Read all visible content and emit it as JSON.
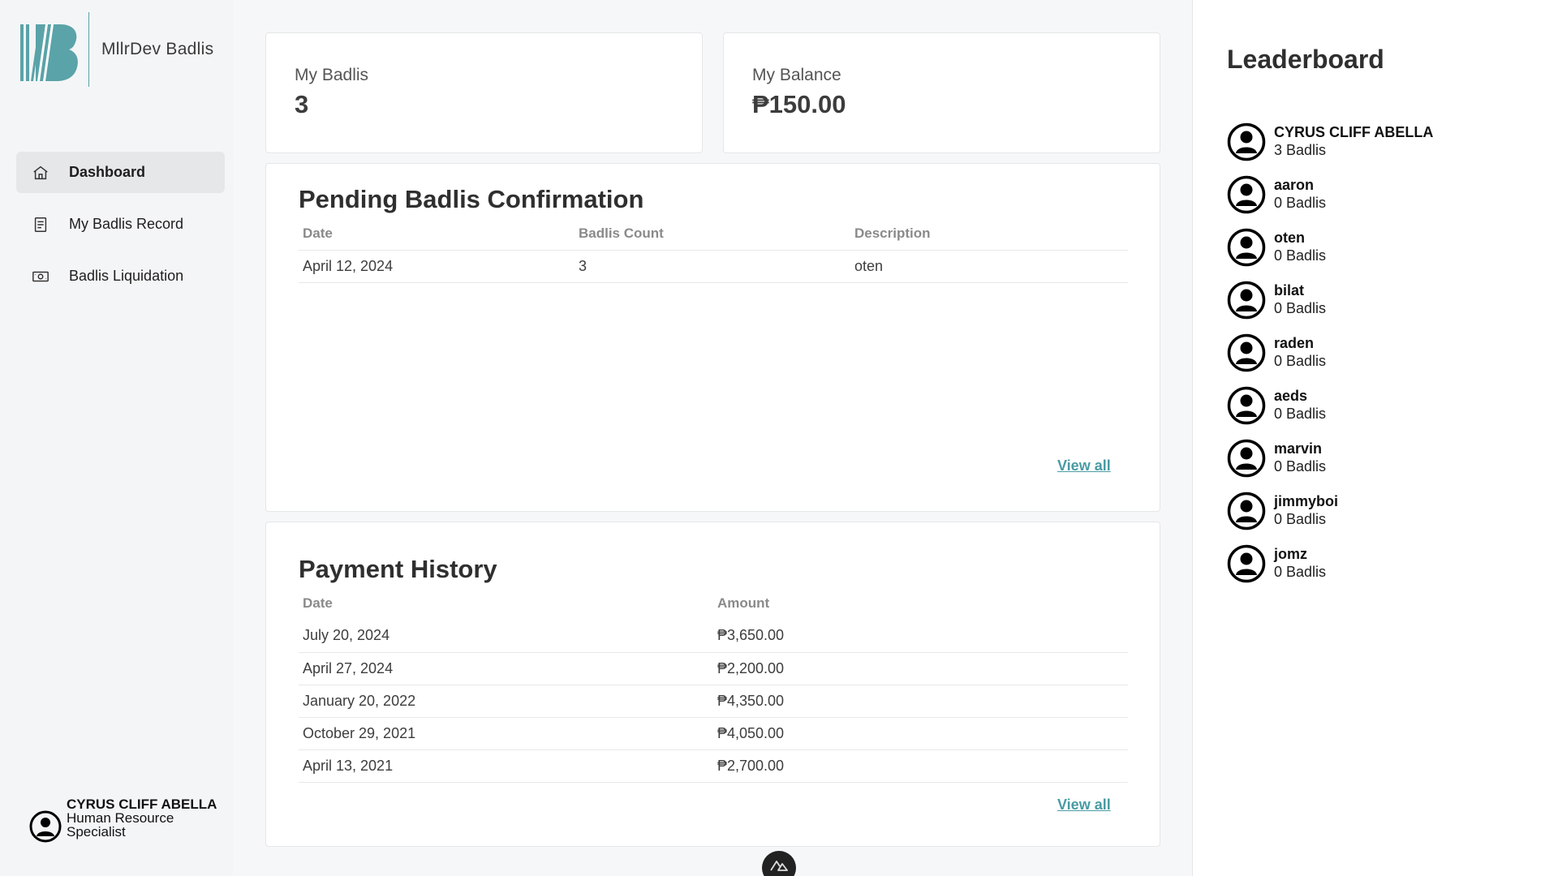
{
  "brand": {
    "name": "MllrDev Badlis",
    "accent": "#5aa3a8"
  },
  "sidebar": {
    "items": [
      {
        "label": "Dashboard",
        "icon": "home-icon",
        "active": true
      },
      {
        "label": "My Badlis Record",
        "icon": "document-icon",
        "active": false
      },
      {
        "label": "Badlis Liquidation",
        "icon": "cash-icon",
        "active": false
      }
    ],
    "user": {
      "name": "CYRUS CLIFF ABELLA",
      "role": "Human Resource Specialist"
    }
  },
  "stats": {
    "badlis": {
      "label": "My Badlis",
      "value": "3"
    },
    "balance": {
      "label": "My Balance",
      "value": "₱150.00"
    }
  },
  "pending": {
    "title": "Pending Badlis Confirmation",
    "columns": [
      "Date",
      "Badlis Count",
      "Description"
    ],
    "rows": [
      [
        "April 12, 2024",
        "3",
        "oten"
      ]
    ],
    "view_all": "View all"
  },
  "payments": {
    "title": "Payment History",
    "columns": [
      "Date",
      "Amount"
    ],
    "rows": [
      [
        "July 20, 2024",
        "₱3,650.00"
      ],
      [
        "April 27, 2024",
        "₱2,200.00"
      ],
      [
        "January 20, 2022",
        "₱4,350.00"
      ],
      [
        "October 29, 2021",
        "₱4,050.00"
      ],
      [
        "April 13, 2021",
        "₱2,700.00"
      ]
    ],
    "view_all": "View all"
  },
  "leaderboard": {
    "title": "Leaderboard",
    "entries": [
      {
        "name": "CYRUS CLIFF ABELLA",
        "count": "3 Badlis"
      },
      {
        "name": "aaron",
        "count": "0 Badlis"
      },
      {
        "name": "oten",
        "count": "0 Badlis"
      },
      {
        "name": "bilat",
        "count": "0 Badlis"
      },
      {
        "name": "raden",
        "count": "0 Badlis"
      },
      {
        "name": "aeds",
        "count": "0 Badlis"
      },
      {
        "name": "marvin",
        "count": "0 Badlis"
      },
      {
        "name": "jimmyboi",
        "count": "0 Badlis"
      },
      {
        "name": "jomz",
        "count": "0 Badlis"
      }
    ]
  }
}
